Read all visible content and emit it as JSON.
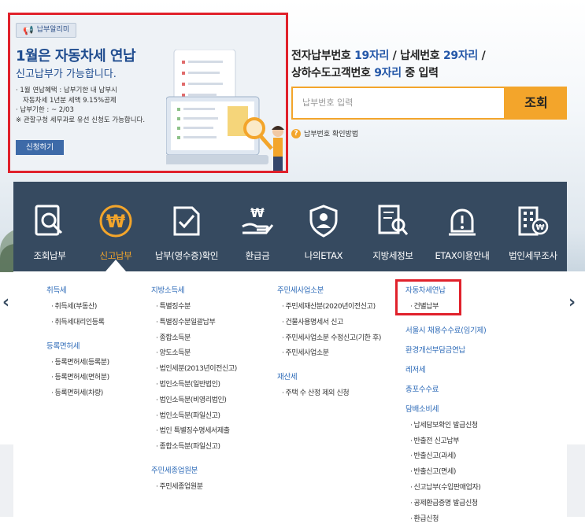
{
  "banner": {
    "badge": "납부알리미",
    "title": "1월은 자동차세 연납",
    "subtitle": "신고납부가 가능합니다.",
    "lines": [
      "· 1월 연납혜택 : 납부기한 내 납부시",
      "  자동차세 1년분 세액 9.15%공제",
      "· 납부기한 : ~ 2/03",
      "※ 관할구청 세무과로 유선 신청도 가능합니다."
    ],
    "apply_button": "신청하기"
  },
  "search": {
    "title_line1_a": "전자납부번호 ",
    "title_line1_b": "19자리",
    "title_line1_c": " / 납세번호 ",
    "title_line1_d": "29자리",
    "title_line1_e": " /",
    "title_line2_a": "상하수도고객번호 ",
    "title_line2_b": "9자리",
    "title_line2_c": " 중 입력",
    "placeholder": "납부번호 입력",
    "button": "조회",
    "help": "납부번호 확인방법"
  },
  "nav": {
    "items": [
      {
        "label": "조회납부",
        "icon": "search-document-icon"
      },
      {
        "label": "신고납부",
        "icon": "won-coin-icon"
      },
      {
        "label": "납부(영수증)확인",
        "icon": "receipt-check-icon"
      },
      {
        "label": "환급금",
        "icon": "hand-won-icon"
      },
      {
        "label": "나의ETAX",
        "icon": "user-shield-icon"
      },
      {
        "label": "지방세정보",
        "icon": "document-search-icon"
      },
      {
        "label": "ETAX이용안내",
        "icon": "alarm-icon"
      },
      {
        "label": "법인세무조사",
        "icon": "building-won-icon"
      }
    ],
    "active_index": 1
  },
  "menu": {
    "col1": {
      "groups": [
        {
          "title": "취득세",
          "items": [
            "취득세(부동산)",
            "취득세대리인등록"
          ]
        },
        {
          "title": "등록면허세",
          "items": [
            "등록면허세(등록분)",
            "등록면허세(면허분)",
            "등록면허세(차량)"
          ]
        }
      ]
    },
    "col2": {
      "groups": [
        {
          "title": "지방소득세",
          "items": [
            "특별징수분",
            "특별징수분일괄납부",
            "종합소득분",
            "양도소득분",
            "법인세분(2013년이전신고)",
            "법인소득분(일반법인)",
            "법인소득분(비영리법인)",
            "법인소득분(파일신고)",
            "법인 특별징수명세서제출",
            "종합소득분(파일신고)"
          ]
        },
        {
          "title": "주민세종업원분",
          "items": [
            "주민세종업원분"
          ]
        }
      ]
    },
    "col3": {
      "groups": [
        {
          "title": "주민세사업소분",
          "items": [
            "주민세재산분(2020년이전신고)",
            "건물사용명세서 신고",
            "주민세사업소분 수정신고(기한 후)",
            "주민세사업소분"
          ]
        },
        {
          "title": "재산세",
          "items": [
            "주택 수 산정 제외 신청"
          ]
        }
      ]
    },
    "col4": {
      "groups": [
        {
          "title": "자동차세연납",
          "items": [
            "건별납부"
          ]
        },
        {
          "title": "서울시 채용수수료(임기제)",
          "items": []
        },
        {
          "title": "환경개선부담금연납",
          "items": []
        },
        {
          "title": "레저세",
          "items": []
        },
        {
          "title": "총포수수료",
          "items": []
        },
        {
          "title": "담배소비세",
          "items": [
            "납세담보확인 발급신청",
            "반출전 신고납부",
            "반출신고(과세)",
            "반출신고(면세)",
            "신고납부(수입판매업자)",
            "공제환급증명 발급신청",
            "환급신청"
          ]
        }
      ]
    }
  },
  "colors": {
    "accent": "#f3a52b",
    "nav_bg": "#364a60",
    "link_blue": "#2e6bb8",
    "highlight_red": "#e0212b"
  }
}
